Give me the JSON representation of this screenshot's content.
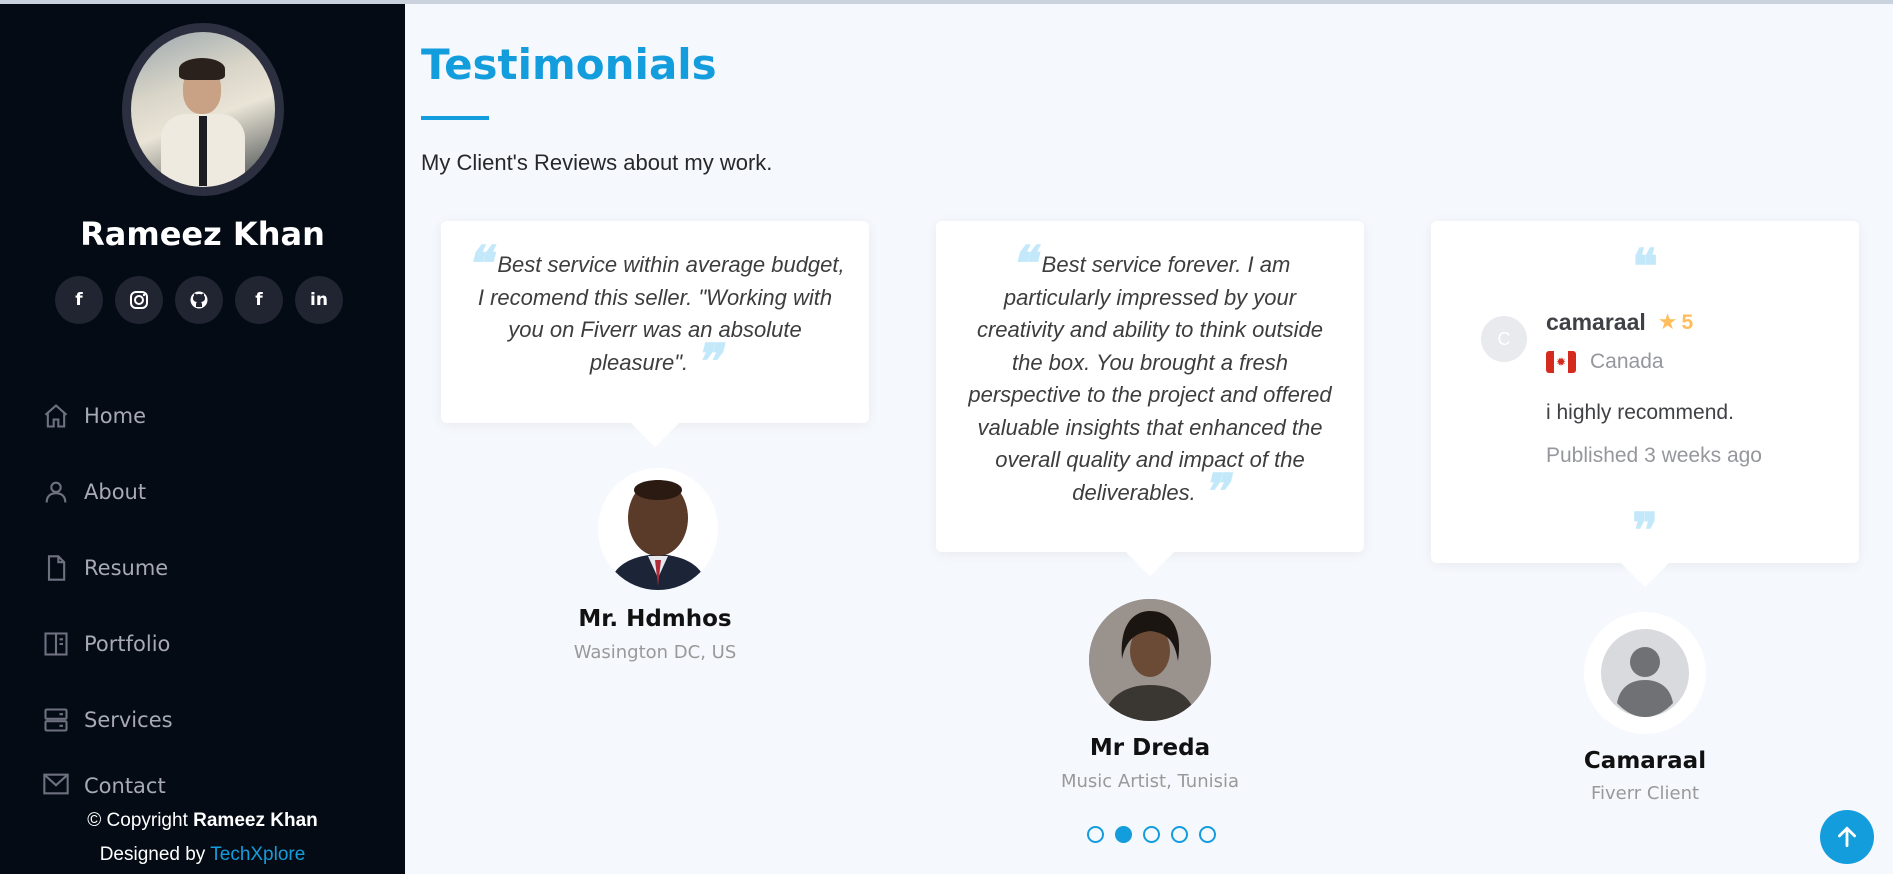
{
  "profile": {
    "name": "Rameez Khan"
  },
  "socials": [
    {
      "icon": "facebook-icon",
      "glyph": "f"
    },
    {
      "icon": "instagram-icon",
      "glyph": "◎"
    },
    {
      "icon": "github-icon",
      "glyph": "⌾"
    },
    {
      "icon": "facebook-icon",
      "glyph": "f"
    },
    {
      "icon": "linkedin-icon",
      "glyph": "in"
    }
  ],
  "nav": [
    {
      "label": "Home",
      "icon": "home-icon"
    },
    {
      "label": "About",
      "icon": "person-icon"
    },
    {
      "label": "Resume",
      "icon": "file-icon"
    },
    {
      "label": "Portfolio",
      "icon": "portfolio-icon"
    },
    {
      "label": "Services",
      "icon": "server-icon"
    },
    {
      "label": "Contact",
      "icon": "envelope-icon"
    }
  ],
  "footer": {
    "copyright_prefix": "© Copyright",
    "copyright_name": "Rameez Khan",
    "designed_prefix": "Designed by",
    "designed_link": "TechXplore"
  },
  "section": {
    "title": "Testimonials",
    "subtitle": "My Client's Reviews about my work."
  },
  "testimonials": [
    {
      "quote": "Best service within average budget, I recomend this seller. \"Working with you on Fiverr was an absolute pleasure\".",
      "name": "Mr. Hdmhos",
      "role": "Wasington DC, US"
    },
    {
      "quote": "Best service forever. I am particularly impressed by your creativity and ability to think outside the box. You brought a fresh perspective to the project and offered valuable insights that enhanced the overall quality and impact of the deliverables.",
      "name": "Mr Dreda",
      "role": "Music Artist, Tunisia"
    },
    {
      "review": {
        "avatar_letter": "C",
        "user": "camaraal",
        "rating": "5",
        "country": "Canada",
        "text": "i highly recommend.",
        "published": "Published 3 weeks ago"
      },
      "name": "Camaraal",
      "role": "Fiverr Client"
    }
  ],
  "carousel": {
    "total_slides": 5,
    "active_index": 1
  },
  "colors": {
    "accent": "#149ddd",
    "sidebar": "#040b14",
    "star": "#ffbe5b"
  }
}
